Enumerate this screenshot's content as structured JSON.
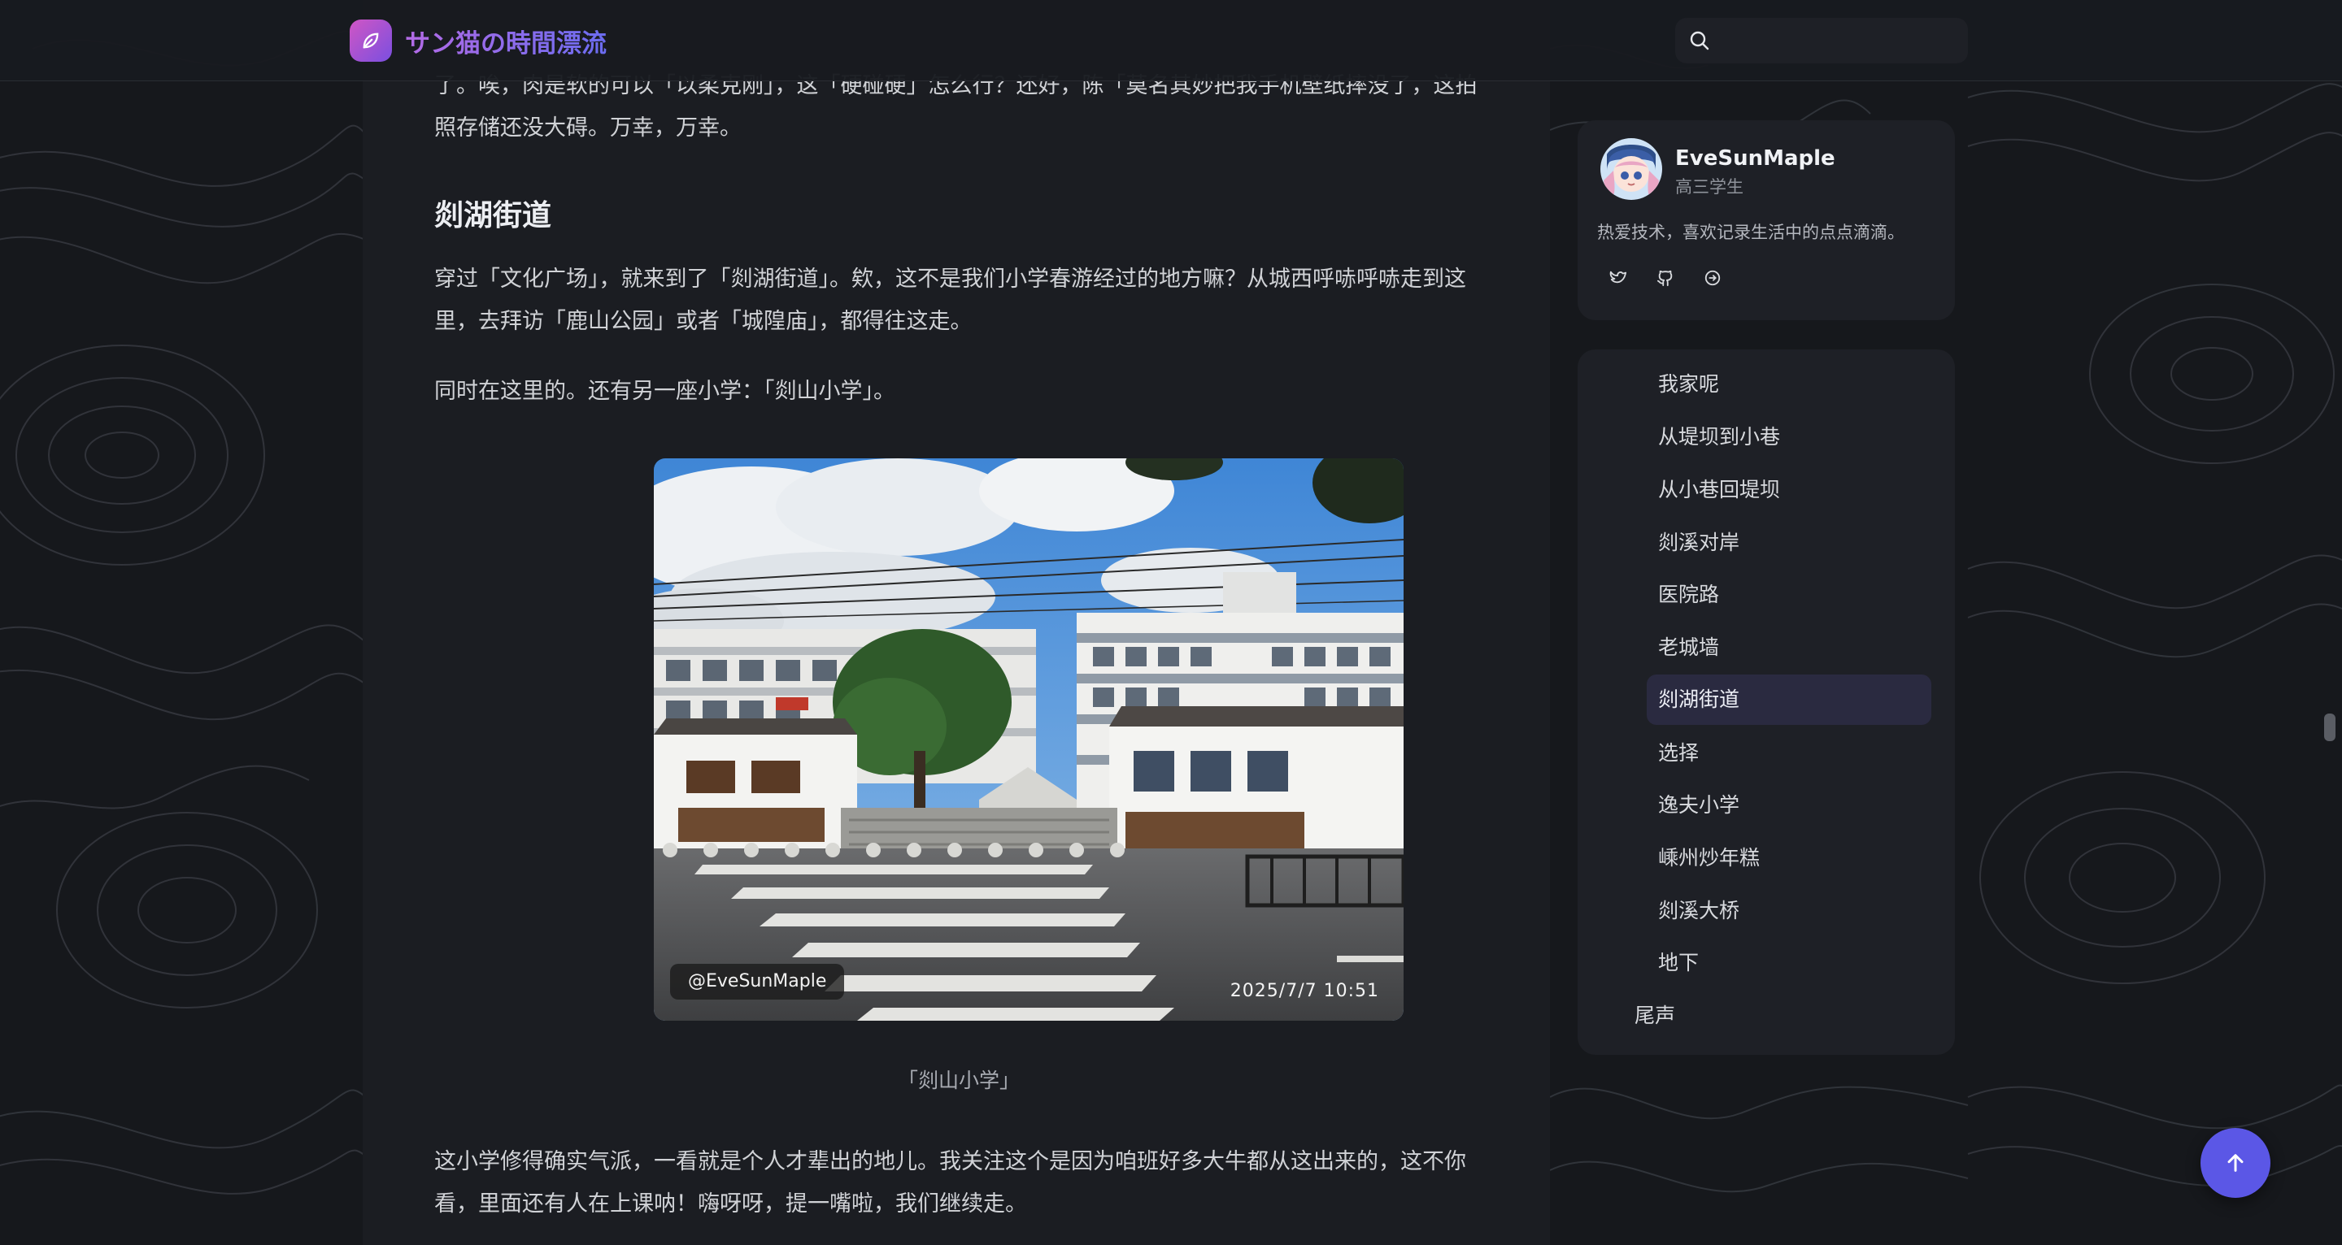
{
  "header": {
    "brand_title": "サン猫の時間漂流",
    "search_placeholder": ""
  },
  "article": {
    "top_paragraph": "了。唉，肉是软的可以「以柔克刚」，这「硬碰硬」怎么行？还好，陈「莫名其妙把我手机壁纸摔没了，这拍照存储还没大碍。万幸，万幸。",
    "section_heading": "剡湖街道",
    "paragraph_1": "穿过「文化广场」，就来到了「剡湖街道」。欸，这不是我们小学春游经过的地方嘛？从城西呼哧呼哧走到这里，去拜访「鹿山公园」或者「城隍庙」，都得往这走。",
    "paragraph_2": "同时在这里的。还有另一座小学：「剡山小学」。",
    "photo": {
      "watermark_author": "@EveSunMaple",
      "watermark_time": "2025/7/7 10:51",
      "caption": "「剡山小学」"
    },
    "paragraph_3": "这小学修得确实气派，一看就是个人才辈出的地儿。我关注这个是因为咱班好多大牛都从这出来的，这不你看，里面还有人在上课呐！嗨呀呀，提一嘴啦，我们继续走。"
  },
  "profile": {
    "name": "EveSunMaple",
    "role": "高三学生",
    "bio": "热爱技术，喜欢记录生活中的点点滴滴。",
    "socials": [
      "twitter-icon",
      "github-icon",
      "link-icon"
    ]
  },
  "toc": {
    "items": [
      {
        "label": "我家呢",
        "active": false,
        "level": 2
      },
      {
        "label": "从堤坝到小巷",
        "active": false,
        "level": 2
      },
      {
        "label": "从小巷回堤坝",
        "active": false,
        "level": 2
      },
      {
        "label": "剡溪对岸",
        "active": false,
        "level": 2
      },
      {
        "label": "医院路",
        "active": false,
        "level": 2
      },
      {
        "label": "老城墙",
        "active": false,
        "level": 2
      },
      {
        "label": "剡湖街道",
        "active": true,
        "level": 2
      },
      {
        "label": "选择",
        "active": false,
        "level": 2
      },
      {
        "label": "逸夫小学",
        "active": false,
        "level": 2
      },
      {
        "label": "嵊州炒年糕",
        "active": false,
        "level": 2
      },
      {
        "label": "剡溪大桥",
        "active": false,
        "level": 2
      },
      {
        "label": "地下",
        "active": false,
        "level": 2
      },
      {
        "label": "尾声",
        "active": false,
        "level": 1
      }
    ]
  },
  "colors": {
    "accent": "#5b57e6",
    "brand_gradient_start": "#b46be6",
    "brand_gradient_end": "#6b6cf0",
    "toc_active_bg": "#2a2a40"
  },
  "controls": {
    "back_to_top_icon": "arrow-up-icon"
  }
}
